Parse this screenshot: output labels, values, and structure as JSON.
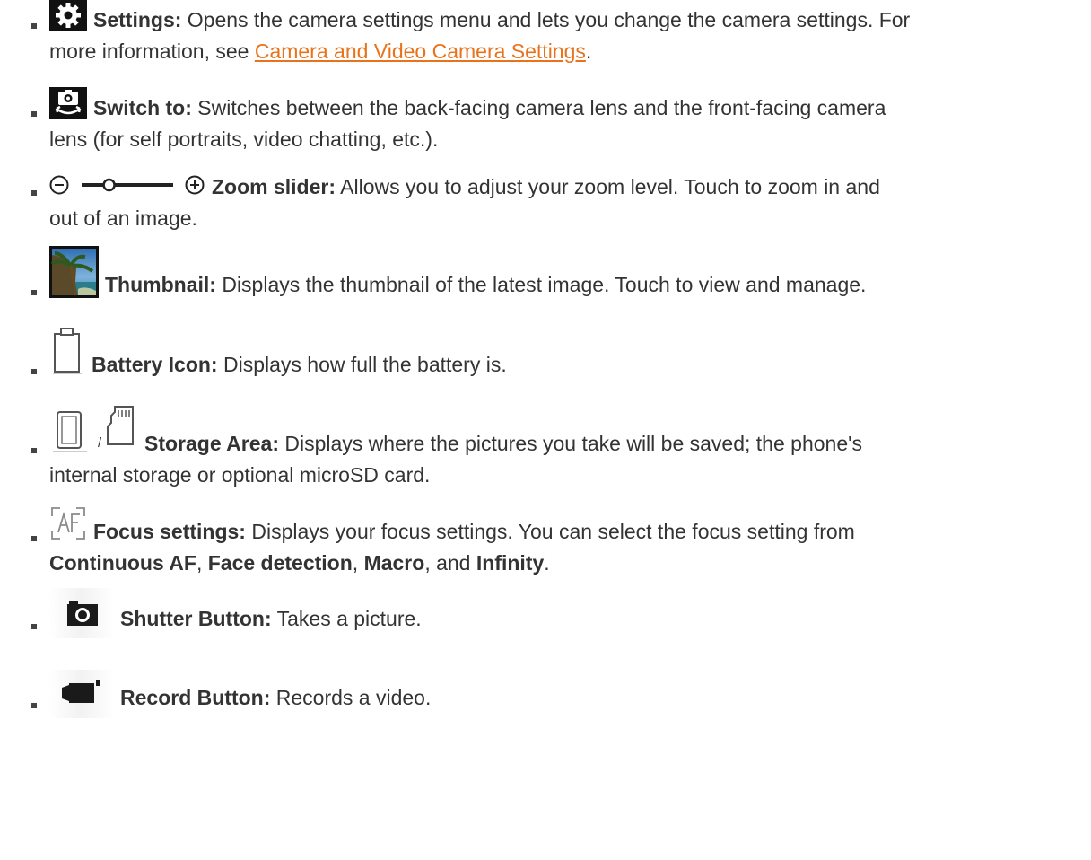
{
  "items": [
    {
      "icon": "gear-icon",
      "label": "Settings:",
      "text_before_link": " Opens the camera settings menu and lets you change the camera settings. For",
      "text_line2_before_link": "more information, see ",
      "link_text": "Camera and Video Camera Settings",
      "text_after_link": "."
    },
    {
      "icon": "switch-camera-icon",
      "label": "Switch to:",
      "text_line1": " Switches between the back-facing camera lens and the front-facing camera",
      "text_line2": "lens (for self portraits, video chatting, etc.)."
    },
    {
      "icon": "zoom-slider-icon",
      "label": "Zoom slider:",
      "text_line1": " Allows you to adjust your zoom level. Touch to zoom in and",
      "text_line2": "out of an image.",
      "zoom_level": 0.3
    },
    {
      "icon": "thumbnail-image-icon",
      "label": "Thumbnail:",
      "text_line1": " Displays the thumbnail of the latest image. Touch to view and manage."
    },
    {
      "icon": "battery-icon",
      "label": "Battery Icon:",
      "text_line1": " Displays how full the battery is."
    },
    {
      "icon": "phone-storage-icon",
      "icon2": "sd-card-icon",
      "separator": "/",
      "label": "Storage Area:",
      "text_line1": " Displays where the pictures you take will be saved; the phone's",
      "text_line2": "internal storage or optional microSD card."
    },
    {
      "icon": "focus-af-icon",
      "label": "Focus settings:",
      "text_line1": " Displays your focus settings. You can select the focus setting from",
      "line2_parts": [
        {
          "text": "Continuous AF",
          "bold": true
        },
        {
          "text": ", ",
          "bold": false
        },
        {
          "text": "Face detection",
          "bold": true
        },
        {
          "text": ", ",
          "bold": false
        },
        {
          "text": "Macro",
          "bold": true
        },
        {
          "text": ", and ",
          "bold": false
        },
        {
          "text": "Infinity",
          "bold": true
        },
        {
          "text": ".",
          "bold": false
        }
      ]
    },
    {
      "icon": "camera-shutter-icon",
      "label": "Shutter Button:",
      "text_line1": " Takes a picture."
    },
    {
      "icon": "video-camera-icon",
      "label": "Record Button:",
      "text_line1": " Records a video."
    }
  ],
  "colors": {
    "text": "#333333",
    "link": "#e8731a",
    "bullet": "#444444"
  }
}
